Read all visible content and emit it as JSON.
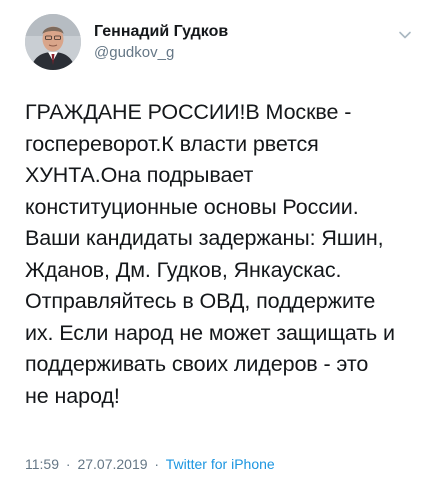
{
  "author": {
    "display_name": "Геннадий Гудков",
    "handle": "@gudkov_g"
  },
  "icons": {
    "menu": "chevron-down-icon",
    "avatar": "profile-photo"
  },
  "tweet": {
    "text": "ГРАЖДАНЕ РОССИИ!В Москве -\nгоспереворот.К власти рвется\nХУНТА.Она подрывает\nконституционные основы России.\nВаши кандидаты задержаны: Яшин,\nЖданов, Дм. Гудков, Янкаускас.\nОтправляйтесь в ОВД, поддержите\nих. Если народ не может защищать и\nподдерживать своих лидеров - это\nне народ!",
    "time": "11:59",
    "date": "27.07.2019",
    "separator": "·",
    "source": "Twitter for iPhone"
  },
  "colors": {
    "text": "#14171a",
    "secondary": "#657786",
    "link": "#1b95e0"
  }
}
